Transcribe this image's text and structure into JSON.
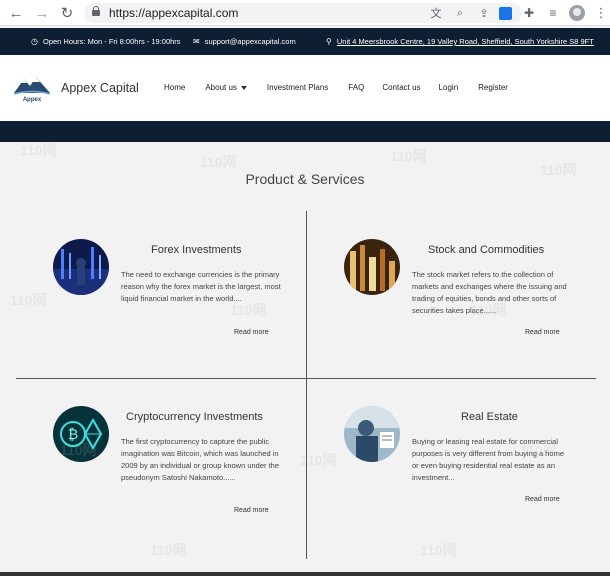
{
  "browser": {
    "url": "https://appexcapital.com"
  },
  "topbar": {
    "hours": "Open Hours: Mon - Fri 8:00hrs - 19:00hrs",
    "email": "support@appexcapital.com",
    "address": "Unit 4 Meersbrook Centre, 19 Valley Road, Sheffield, South Yorkshire S8 9FT"
  },
  "header": {
    "logo_text": "Appex",
    "brand": "Appex Capital",
    "nav": [
      "Home",
      "About us",
      "Investment Plans",
      "FAQ",
      "Contact us",
      "Login",
      "Register"
    ]
  },
  "main": {
    "title": "Product & Services",
    "cards": [
      {
        "title": "Forex Investments",
        "text": "The need to exchange currencies is the primary reason why the forex market is the largest, most liquid financial market in the world....",
        "read_more": "Read more"
      },
      {
        "title": "Stock and Commodities",
        "text": "The stock market refers to the collection of markets and exchanges where the issuing and trading of equities, bonds and other sorts of securities takes place......",
        "read_more": "Read more"
      },
      {
        "title": "Cryptocurrency Investments",
        "text": "The first cryptocurrency to capture the public imagination was Bitcoin, which was launched in 2009 by an individual or group known under the pseudonym Satoshi Nakamoto......",
        "read_more": "Read more"
      },
      {
        "title": "Real Estate",
        "text": "Buying or leasing real estate for commercial purposes is very different from buying a home or even buying residential real estate as an investment...",
        "read_more": "Read more"
      }
    ]
  },
  "watermark": "110网",
  "colors": {
    "dark_navy": "#0f1f33",
    "page_bg": "#f2f2f2",
    "divider": "#555555"
  }
}
